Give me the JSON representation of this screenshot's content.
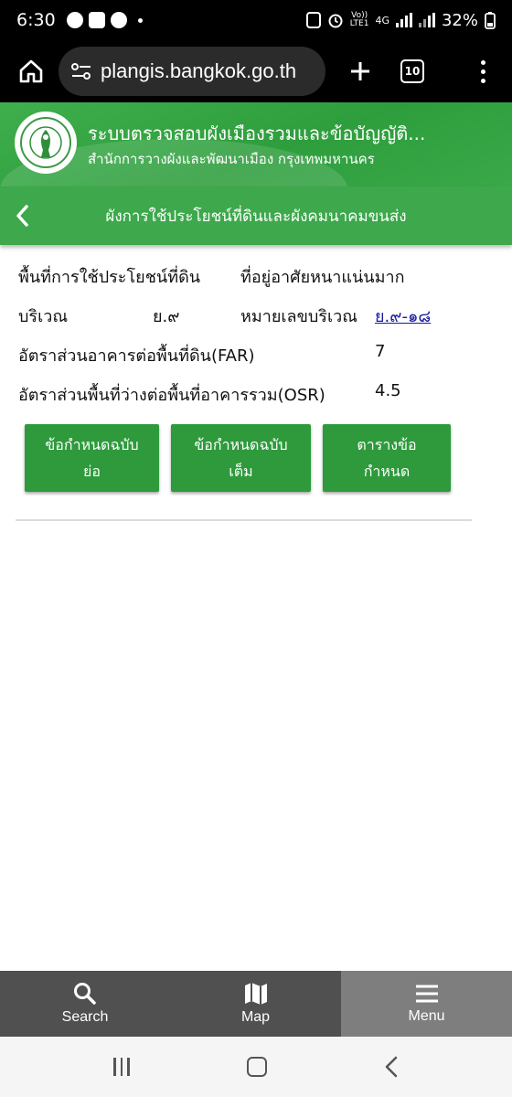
{
  "status_bar": {
    "time": "6:30",
    "network": "4G",
    "battery": "32%",
    "volte_top": "Vo))",
    "volte_bottom": "LTE1"
  },
  "browser": {
    "url": "plangis.bangkok.go.th",
    "tab_count": "10"
  },
  "site": {
    "title": "ระบบตรวจสอบผังเมืองรวมและข้อบัญญัติ...",
    "subtitle": "สำนักการวางผังและพัฒนาเมือง กรุงเทพมหานคร"
  },
  "page": {
    "subtitle": "ผังการใช้ประโยชน์ที่ดินและผังคมนาคมขนส่ง"
  },
  "info": {
    "land_use_label": "พื้นที่การใช้ประโยชน์ที่ดิน",
    "land_use_value": "ที่อยู่อาศัยหนาแน่นมาก",
    "zone_label": "บริเวณ",
    "zone_value": "ย.๙",
    "zone_number_label": "หมายเลขบริเวณ",
    "zone_number_value": "ย.๙-๑๘",
    "far_label": "อัตราส่วนอาคารต่อพื้นที่ดิน(FAR)",
    "far_value": "7",
    "osr_label": "อัตราส่วนพื้นที่ว่างต่อพื้นที่อาคารรวม(OSR)",
    "osr_value": "4.5"
  },
  "buttons": {
    "short_line1": "ข้อกำหนดฉบับ",
    "short_line2": "ย่อ",
    "full_line1": "ข้อกำหนดฉบับ",
    "full_line2": "เต็ม",
    "table_line1": "ตารางข้อ",
    "table_line2": "กำหนด"
  },
  "bottom_nav": {
    "search": "Search",
    "map": "Map",
    "menu": "Menu"
  },
  "icons": [
    "home-icon",
    "site-settings-icon",
    "plus-icon",
    "tabs-icon",
    "more-icon",
    "back-chevron-icon",
    "search-icon",
    "map-icon",
    "menu-icon"
  ],
  "colors": {
    "header_green": "#2e9e3d",
    "button_green": "#2e9a3c",
    "link_blue": "#1a1aa0",
    "nav_gray": "#505050"
  }
}
